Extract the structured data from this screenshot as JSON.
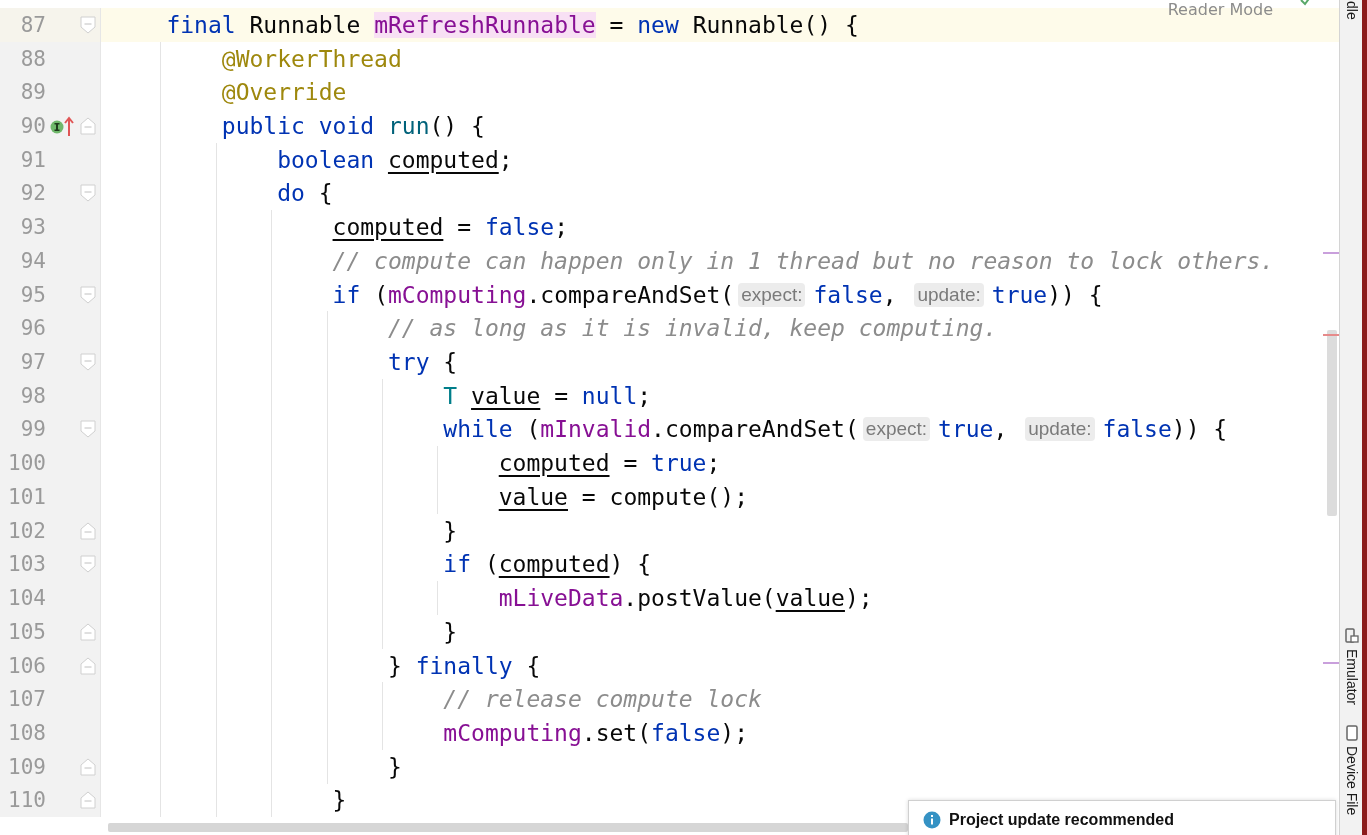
{
  "reader_mode": {
    "label": "Reader Mode"
  },
  "lines": [
    {
      "number": "87",
      "current": true,
      "fold_open": true,
      "fold_close": false,
      "implements_marker": false,
      "tokens": [
        {
          "kind": "keyword",
          "text": "    final"
        },
        {
          "kind": "plain",
          "text": " Runnable "
        },
        {
          "kind": "usage",
          "text": "mRefreshRunnable"
        },
        {
          "kind": "plain",
          "text": " = "
        },
        {
          "kind": "keyword",
          "text": "new"
        },
        {
          "kind": "plain",
          "text": " Runnable() {"
        }
      ]
    },
    {
      "number": "88",
      "current": false,
      "fold_open": false,
      "fold_close": false,
      "implements_marker": false,
      "tokens": [
        {
          "kind": "annotation",
          "text": "        @WorkerThread"
        }
      ]
    },
    {
      "number": "89",
      "current": false,
      "fold_open": false,
      "fold_close": false,
      "implements_marker": false,
      "tokens": [
        {
          "kind": "annotation",
          "text": "        @Override"
        }
      ]
    },
    {
      "number": "90",
      "current": false,
      "fold_open": false,
      "fold_close": true,
      "implements_marker": true,
      "tokens": [
        {
          "kind": "keyword",
          "text": "        public void "
        },
        {
          "kind": "method",
          "text": "run"
        },
        {
          "kind": "plain",
          "text": "() {"
        }
      ]
    },
    {
      "number": "91",
      "current": false,
      "fold_open": false,
      "fold_close": false,
      "implements_marker": false,
      "tokens": [
        {
          "kind": "keyword",
          "text": "            boolean "
        },
        {
          "kind": "local",
          "text": "computed"
        },
        {
          "kind": "plain",
          "text": ";"
        }
      ]
    },
    {
      "number": "92",
      "current": false,
      "fold_open": true,
      "fold_close": false,
      "implements_marker": false,
      "tokens": [
        {
          "kind": "keyword",
          "text": "            do"
        },
        {
          "kind": "plain",
          "text": " {"
        }
      ]
    },
    {
      "number": "93",
      "current": false,
      "fold_open": false,
      "fold_close": false,
      "implements_marker": false,
      "tokens": [
        {
          "kind": "local",
          "text": "                computed"
        },
        {
          "kind": "plain",
          "text": " = "
        },
        {
          "kind": "keyword",
          "text": "false"
        },
        {
          "kind": "plain",
          "text": ";"
        }
      ]
    },
    {
      "number": "94",
      "current": false,
      "fold_open": false,
      "fold_close": false,
      "implements_marker": false,
      "tokens": [
        {
          "kind": "comment",
          "text": "                // compute can happen only in 1 thread but no reason to lock others."
        }
      ]
    },
    {
      "number": "95",
      "current": false,
      "fold_open": true,
      "fold_close": false,
      "implements_marker": false,
      "tokens": [
        {
          "kind": "keyword",
          "text": "                if"
        },
        {
          "kind": "plain",
          "text": " ("
        },
        {
          "kind": "field",
          "text": "mComputing"
        },
        {
          "kind": "plain",
          "text": ".compareAndSet("
        },
        {
          "kind": "hint",
          "text": "expect:"
        },
        {
          "kind": "keyword",
          "text": "false"
        },
        {
          "kind": "plain",
          "text": ", "
        },
        {
          "kind": "hint",
          "text": "update:"
        },
        {
          "kind": "keyword",
          "text": "true"
        },
        {
          "kind": "plain",
          "text": ")) {"
        }
      ]
    },
    {
      "number": "96",
      "current": false,
      "fold_open": false,
      "fold_close": false,
      "implements_marker": false,
      "tokens": [
        {
          "kind": "comment",
          "text": "                    // as long as it is invalid, keep computing."
        }
      ]
    },
    {
      "number": "97",
      "current": false,
      "fold_open": true,
      "fold_close": false,
      "implements_marker": false,
      "tokens": [
        {
          "kind": "keyword",
          "text": "                    try"
        },
        {
          "kind": "plain",
          "text": " {"
        }
      ]
    },
    {
      "number": "98",
      "current": false,
      "fold_open": false,
      "fold_close": false,
      "implements_marker": false,
      "tokens": [
        {
          "kind": "type",
          "text": "                        T "
        },
        {
          "kind": "local",
          "text": "value"
        },
        {
          "kind": "plain",
          "text": " = "
        },
        {
          "kind": "keyword",
          "text": "null"
        },
        {
          "kind": "plain",
          "text": ";"
        }
      ]
    },
    {
      "number": "99",
      "current": false,
      "fold_open": true,
      "fold_close": false,
      "implements_marker": false,
      "tokens": [
        {
          "kind": "keyword",
          "text": "                        while"
        },
        {
          "kind": "plain",
          "text": " ("
        },
        {
          "kind": "field",
          "text": "mInvalid"
        },
        {
          "kind": "plain",
          "text": ".compareAndSet("
        },
        {
          "kind": "hint",
          "text": "expect:"
        },
        {
          "kind": "keyword",
          "text": "true"
        },
        {
          "kind": "plain",
          "text": ", "
        },
        {
          "kind": "hint",
          "text": "update:"
        },
        {
          "kind": "keyword",
          "text": "false"
        },
        {
          "kind": "plain",
          "text": ")) {"
        }
      ]
    },
    {
      "number": "100",
      "current": false,
      "fold_open": false,
      "fold_close": false,
      "implements_marker": false,
      "tokens": [
        {
          "kind": "local",
          "text": "                            computed"
        },
        {
          "kind": "plain",
          "text": " = "
        },
        {
          "kind": "keyword",
          "text": "true"
        },
        {
          "kind": "plain",
          "text": ";"
        }
      ]
    },
    {
      "number": "101",
      "current": false,
      "fold_open": false,
      "fold_close": false,
      "implements_marker": false,
      "tokens": [
        {
          "kind": "local",
          "text": "                            value"
        },
        {
          "kind": "plain",
          "text": " = compute();"
        }
      ]
    },
    {
      "number": "102",
      "current": false,
      "fold_open": false,
      "fold_close": true,
      "implements_marker": false,
      "tokens": [
        {
          "kind": "plain",
          "text": "                        }"
        }
      ]
    },
    {
      "number": "103",
      "current": false,
      "fold_open": true,
      "fold_close": false,
      "implements_marker": false,
      "tokens": [
        {
          "kind": "keyword",
          "text": "                        if"
        },
        {
          "kind": "plain",
          "text": " ("
        },
        {
          "kind": "local",
          "text": "computed"
        },
        {
          "kind": "plain",
          "text": ") {"
        }
      ]
    },
    {
      "number": "104",
      "current": false,
      "fold_open": false,
      "fold_close": false,
      "implements_marker": false,
      "tokens": [
        {
          "kind": "field",
          "text": "                            mLiveData"
        },
        {
          "kind": "plain",
          "text": ".postValue("
        },
        {
          "kind": "local",
          "text": "value"
        },
        {
          "kind": "plain",
          "text": ");"
        }
      ]
    },
    {
      "number": "105",
      "current": false,
      "fold_open": false,
      "fold_close": true,
      "implements_marker": false,
      "tokens": [
        {
          "kind": "plain",
          "text": "                        }"
        }
      ]
    },
    {
      "number": "106",
      "current": false,
      "fold_open": false,
      "fold_close": true,
      "implements_marker": false,
      "tokens": [
        {
          "kind": "plain",
          "text": "                    } "
        },
        {
          "kind": "keyword",
          "text": "finally"
        },
        {
          "kind": "plain",
          "text": " {"
        }
      ]
    },
    {
      "number": "107",
      "current": false,
      "fold_open": false,
      "fold_close": false,
      "implements_marker": false,
      "tokens": [
        {
          "kind": "comment",
          "text": "                        // release compute lock"
        }
      ]
    },
    {
      "number": "108",
      "current": false,
      "fold_open": false,
      "fold_close": false,
      "implements_marker": false,
      "tokens": [
        {
          "kind": "field",
          "text": "                        mComputing"
        },
        {
          "kind": "plain",
          "text": ".set("
        },
        {
          "kind": "keyword",
          "text": "false"
        },
        {
          "kind": "plain",
          "text": ");"
        }
      ]
    },
    {
      "number": "109",
      "current": false,
      "fold_open": false,
      "fold_close": true,
      "implements_marker": false,
      "tokens": [
        {
          "kind": "plain",
          "text": "                    }"
        }
      ]
    },
    {
      "number": "110",
      "current": false,
      "fold_open": false,
      "fold_close": true,
      "implements_marker": false,
      "tokens": [
        {
          "kind": "plain",
          "text": "                }"
        }
      ]
    }
  ],
  "right_toolbar": [
    {
      "kind": "plain",
      "label": "dle"
    },
    {
      "kind": "device",
      "label": "Emulator"
    },
    {
      "kind": "phone",
      "label": "Device File"
    }
  ],
  "notification": {
    "kind": "info",
    "title": "Project update recommended"
  }
}
